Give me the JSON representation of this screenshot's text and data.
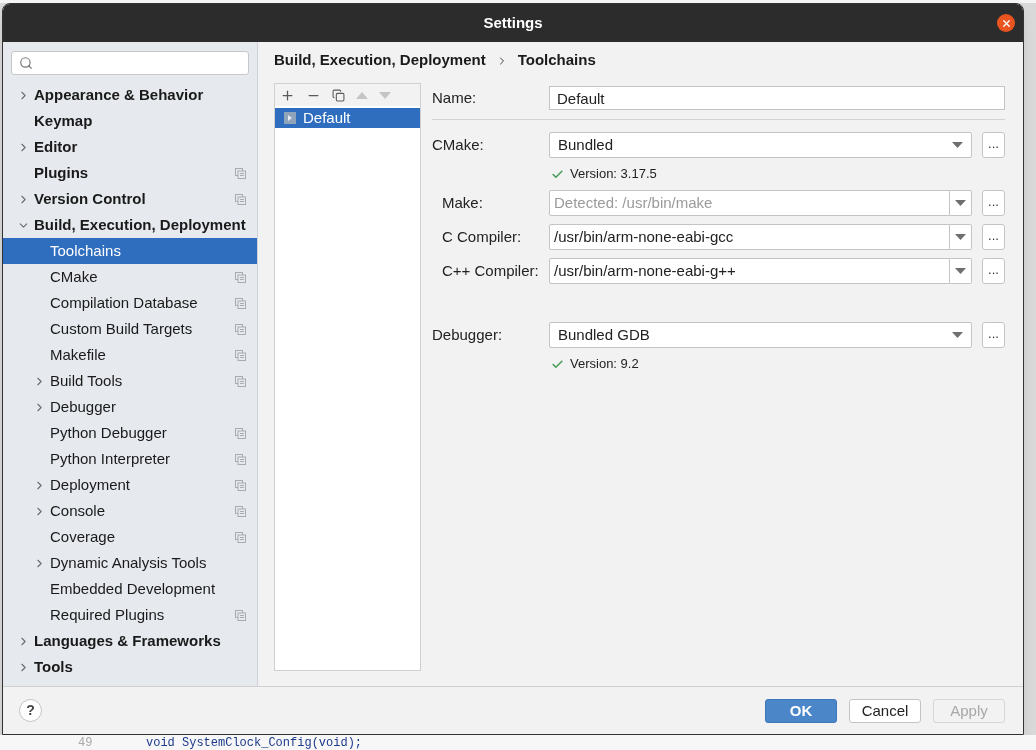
{
  "window": {
    "title": "Settings"
  },
  "sidebar": {
    "items": [
      {
        "label": "Appearance & Behavior",
        "kind": "folder",
        "expanded": false,
        "bold": true,
        "selected": false,
        "project_icon": false
      },
      {
        "label": "Keymap",
        "kind": "leaf",
        "bold": true,
        "selected": false,
        "project_icon": false
      },
      {
        "label": "Editor",
        "kind": "folder",
        "expanded": false,
        "bold": true,
        "selected": false,
        "project_icon": false
      },
      {
        "label": "Plugins",
        "kind": "leaf",
        "bold": true,
        "selected": false,
        "project_icon": true
      },
      {
        "label": "Version Control",
        "kind": "folder",
        "expanded": false,
        "bold": true,
        "selected": false,
        "project_icon": true
      },
      {
        "label": "Build, Execution, Deployment",
        "kind": "folder",
        "expanded": true,
        "bold": true,
        "selected": false,
        "project_icon": false,
        "children": [
          {
            "label": "Toolchains",
            "kind": "leaf",
            "bold": false,
            "selected": true,
            "project_icon": false
          },
          {
            "label": "CMake",
            "kind": "leaf",
            "bold": false,
            "selected": false,
            "project_icon": true
          },
          {
            "label": "Compilation Database",
            "kind": "leaf",
            "bold": false,
            "selected": false,
            "project_icon": true
          },
          {
            "label": "Custom Build Targets",
            "kind": "leaf",
            "bold": false,
            "selected": false,
            "project_icon": true
          },
          {
            "label": "Makefile",
            "kind": "leaf",
            "bold": false,
            "selected": false,
            "project_icon": true
          },
          {
            "label": "Build Tools",
            "kind": "folder",
            "expanded": false,
            "bold": false,
            "selected": false,
            "project_icon": true
          },
          {
            "label": "Debugger",
            "kind": "folder",
            "expanded": false,
            "bold": false,
            "selected": false,
            "project_icon": false
          },
          {
            "label": "Python Debugger",
            "kind": "leaf",
            "bold": false,
            "selected": false,
            "project_icon": true
          },
          {
            "label": "Python Interpreter",
            "kind": "leaf",
            "bold": false,
            "selected": false,
            "project_icon": true
          },
          {
            "label": "Deployment",
            "kind": "folder",
            "expanded": false,
            "bold": false,
            "selected": false,
            "project_icon": true
          },
          {
            "label": "Console",
            "kind": "folder",
            "expanded": false,
            "bold": false,
            "selected": false,
            "project_icon": true
          },
          {
            "label": "Coverage",
            "kind": "leaf",
            "bold": false,
            "selected": false,
            "project_icon": true
          },
          {
            "label": "Dynamic Analysis Tools",
            "kind": "folder",
            "expanded": false,
            "bold": false,
            "selected": false,
            "project_icon": false
          },
          {
            "label": "Embedded Development",
            "kind": "leaf",
            "bold": false,
            "selected": false,
            "project_icon": false
          },
          {
            "label": "Required Plugins",
            "kind": "leaf",
            "bold": false,
            "selected": false,
            "project_icon": true
          }
        ]
      },
      {
        "label": "Languages & Frameworks",
        "kind": "folder",
        "expanded": false,
        "bold": true,
        "selected": false,
        "project_icon": false
      },
      {
        "label": "Tools",
        "kind": "folder",
        "expanded": false,
        "bold": true,
        "selected": false,
        "project_icon": false
      }
    ]
  },
  "breadcrumb": [
    {
      "label": "Build, Execution, Deployment"
    },
    {
      "label": "Toolchains"
    }
  ],
  "toolchains": {
    "toolbar": [
      {
        "kind": "add",
        "disabled": false
      },
      {
        "kind": "remove",
        "disabled": false
      },
      {
        "kind": "copy",
        "disabled": false
      },
      {
        "kind": "up",
        "disabled": true
      },
      {
        "kind": "down",
        "disabled": true
      }
    ],
    "items": [
      {
        "label": "Default",
        "selected": true
      }
    ]
  },
  "form": {
    "name": {
      "label": "Name:",
      "value": "Default"
    },
    "rows": [
      {
        "kind": "combo",
        "label": "CMake:",
        "value": "Bundled",
        "version": "Version: 3.17.5"
      },
      {
        "kind": "editable_combo",
        "label": "Make:",
        "placeholder": "Detected: /usr/bin/make"
      },
      {
        "kind": "editable_combo",
        "label": "C Compiler:",
        "value": "/usr/bin/arm-none-eabi-gcc"
      },
      {
        "kind": "editable_combo",
        "label": "C++ Compiler:",
        "value": "/usr/bin/arm-none-eabi-g++"
      },
      {
        "kind": "spacer"
      },
      {
        "kind": "combo",
        "label": "Debugger:",
        "value": "Bundled GDB",
        "version": "Version: 9.2"
      }
    ],
    "browse_label": "..."
  },
  "footer": {
    "help": "?",
    "buttons": [
      {
        "label": "OK",
        "kind": "primary",
        "disabled": false
      },
      {
        "label": "Cancel",
        "kind": "normal",
        "disabled": false
      },
      {
        "label": "Apply",
        "kind": "normal",
        "disabled": true
      }
    ]
  },
  "editor_behind": {
    "line_number": "49",
    "code": "void SystemClock_Config(void);"
  }
}
